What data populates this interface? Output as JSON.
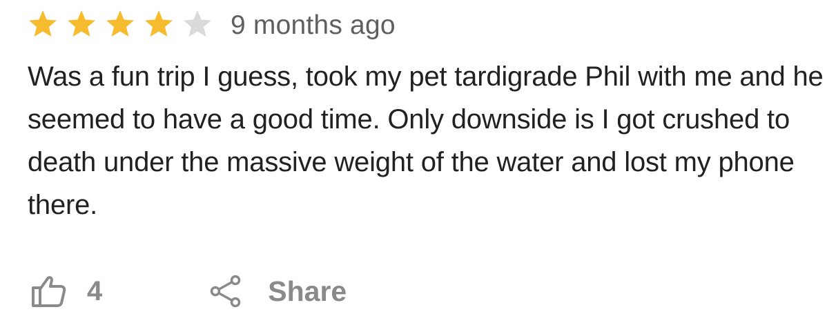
{
  "review": {
    "rating": 4,
    "max_rating": 5,
    "timestamp": "9 months ago",
    "text": "Was a fun trip I guess, took my pet tardigrade Phil with me and he seemed to have a good time. Only downside is I got crushed to death under the massive weight of the water and lost my phone there."
  },
  "actions": {
    "like_count": "4",
    "share_label": "Share"
  },
  "colors": {
    "star_filled": "#F6BB2F",
    "star_empty": "#DADADA",
    "text": "#212121",
    "muted": "#8A8A8A"
  },
  "icons": [
    "star-icon",
    "thumbs-up-icon",
    "share-icon"
  ]
}
